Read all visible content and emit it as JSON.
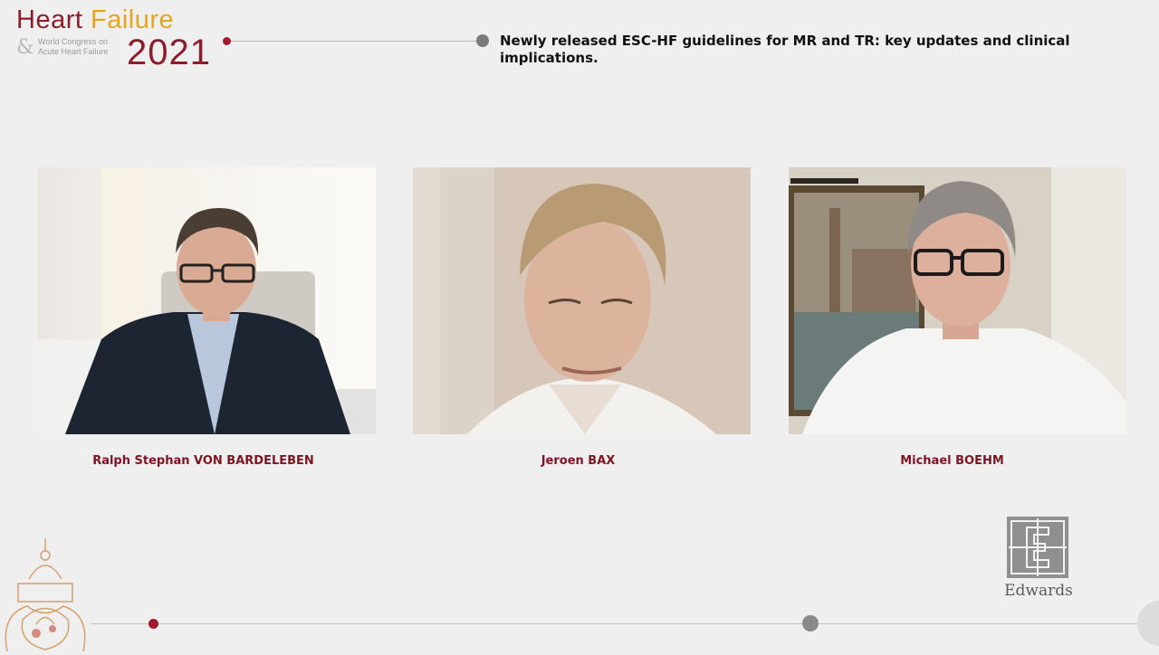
{
  "logo": {
    "word1": "Heart",
    "word2": "Failure",
    "ampersand": "&",
    "subtitle_line1": "World Congress on",
    "subtitle_line2": "Acute Heart Failure",
    "year": "2021"
  },
  "session_title": "Newly released ESC-HF guidelines for MR and TR: key updates and clinical implications.",
  "speakers": [
    {
      "name": "Ralph Stephan VON BARDELEBEN"
    },
    {
      "name": "Jeroen BAX"
    },
    {
      "name": "Michael BOEHM"
    }
  ],
  "sponsor": {
    "name": "Edwards"
  },
  "colors": {
    "brand_red": "#8c1d2b",
    "brand_gold": "#e6a521",
    "background": "#efefef",
    "speaker_name": "#7d1424"
  }
}
